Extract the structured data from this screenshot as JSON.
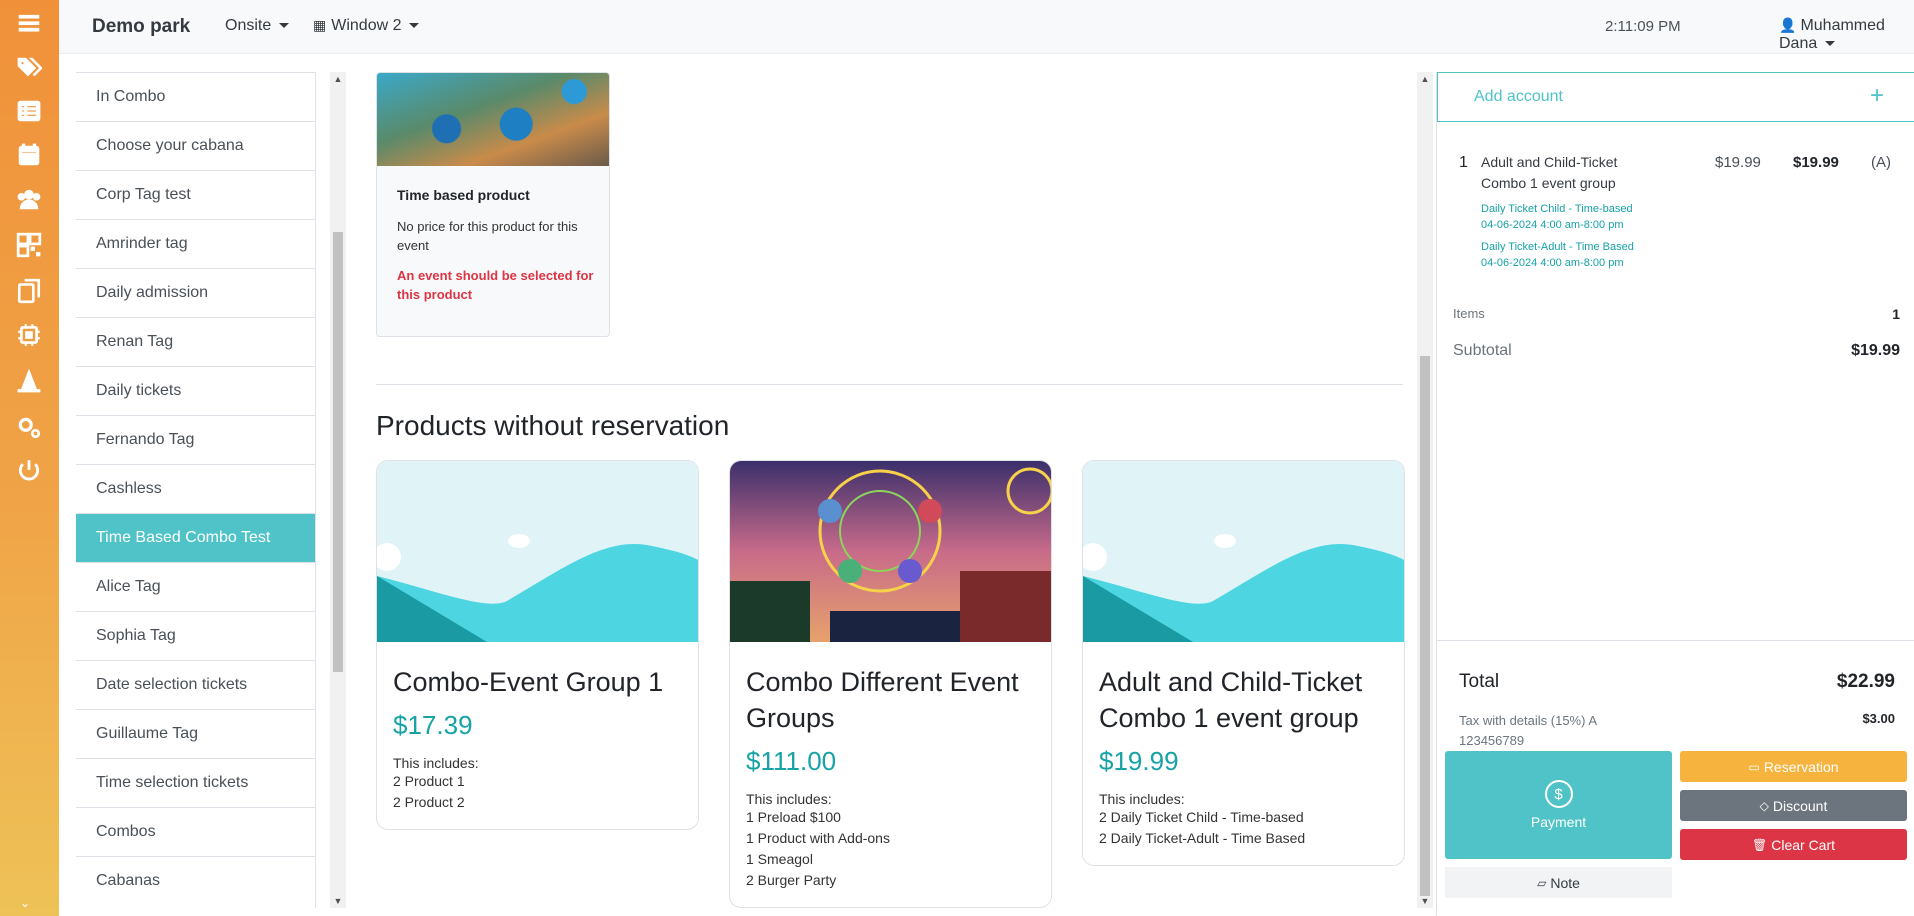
{
  "header": {
    "brand": "Demo park",
    "mode_dropdown": "Onsite",
    "window_dropdown": "Window 2",
    "time": "2:11:09 PM",
    "user": "Muhammed Dana"
  },
  "rail": {
    "icons": [
      "menu-icon",
      "tags-icon",
      "list-icon",
      "calendar-icon",
      "users-icon",
      "qr-code-icon",
      "copy-icon",
      "chip-icon",
      "cone-icon",
      "settings-icon",
      "power-icon"
    ]
  },
  "categories": [
    "In Combo",
    "Choose your cabana",
    "Corp Tag test",
    "Amrinder tag",
    "Daily admission",
    "Renan Tag",
    "Daily tickets",
    "Fernando Tag",
    "Cashless",
    "Time Based Combo Test",
    "Alice Tag",
    "Sophia Tag",
    "Date selection tickets",
    "Guillaume Tag",
    "Time selection tickets",
    "Combos",
    "Cabanas"
  ],
  "active_category": "Time Based Combo Test",
  "time_card": {
    "title": "Time based product",
    "note": "No price for this product for this event",
    "warning": "An event should be selected for this product"
  },
  "section_title": "Products without reservation",
  "products": [
    {
      "name": "Combo-Event Group 1",
      "price": "$17.39",
      "includes_label": "This includes:",
      "lines": [
        "2 Product 1",
        "2 Product 2"
      ]
    },
    {
      "name": "Combo Different Event Groups",
      "price": "$111.00",
      "includes_label": "This includes:",
      "lines": [
        "1 Preload $100",
        "1 Product with Add-ons",
        "1 Smeagol",
        "2 Burger Party"
      ]
    },
    {
      "name": "Adult and Child-Ticket Combo 1 event group",
      "price": "$19.99",
      "includes_label": "This includes:",
      "lines": [
        "2 Daily Ticket Child - Time-based",
        "2 Daily Ticket-Adult - Time Based"
      ]
    }
  ],
  "cart": {
    "add_account": "Add account",
    "add_icon": "+",
    "item": {
      "qty": "1",
      "name": "Adult and Child-Ticket Combo 1 event group",
      "unit_price": "$19.99",
      "line_total": "$19.99",
      "tax_code": "(A)",
      "sub1_name": "Daily Ticket Child - Time-based",
      "sub1_time": "04-06-2024 4:00 am-8:00 pm",
      "sub2_name": "Daily Ticket-Adult - Time Based",
      "sub2_time": "04-06-2024 4:00 am-8:00 pm"
    },
    "items_label": "Items",
    "items_count": "1",
    "subtotal_label": "Subtotal",
    "subtotal": "$19.99",
    "total_label": "Total",
    "total": "$22.99",
    "tax_label": "Tax with details (15%) A 123456789",
    "tax_value": "$3.00",
    "payment_label": "Payment",
    "reservation_label": "Reservation",
    "discount_label": "Discount",
    "clear_label": "Clear Cart",
    "note_label": "Note"
  },
  "colors": {
    "accent": "#4fc3c7",
    "price": "#17a2a6",
    "warning": "#dc3545",
    "reservation": "#f6b33d",
    "discount": "#6c757d"
  }
}
